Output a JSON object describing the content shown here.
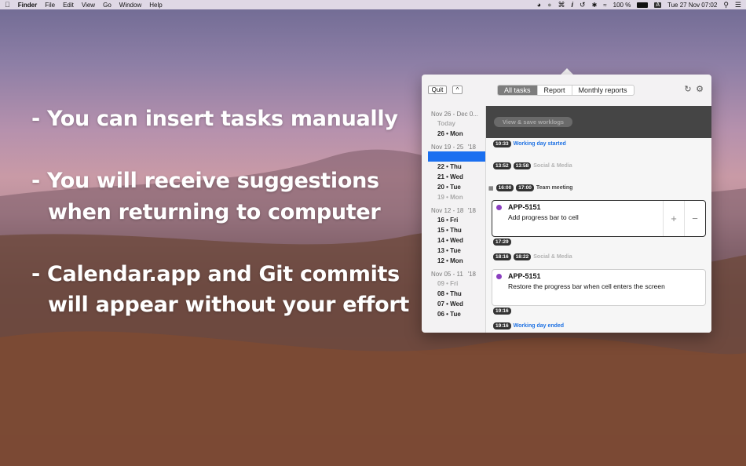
{
  "menubar": {
    "apple_icon": "apple-icon",
    "items": [
      "Finder",
      "File",
      "Edit",
      "View",
      "Go",
      "Window",
      "Help"
    ],
    "battery": "100 %",
    "input_source": "A",
    "datetime": "Tue 27 Nov  07:02"
  },
  "promo": {
    "line1": "- You can insert tasks manually",
    "line2a": "- You will receive suggestions",
    "line2b": "when returning to computer",
    "line3a": "- Calendar.app and Git commits",
    "line3b": "will appear without your effort"
  },
  "toolbar": {
    "quit_label": "Quit",
    "collapse_label": "^",
    "tabs": [
      "All tasks",
      "Report",
      "Monthly reports"
    ],
    "active_tab": "All tasks",
    "refresh_icon": "refresh-icon",
    "settings_icon": "gear-icon"
  },
  "sidebar": {
    "weeks": [
      {
        "header": "Nov 26 - Dec 0...",
        "year": "",
        "days": [
          {
            "label": "Today",
            "dim": true
          },
          {
            "label": "26 • Mon",
            "dim": false
          }
        ]
      },
      {
        "header": "Nov 19 - 25",
        "year": "'18",
        "days": [
          {
            "label": "",
            "selected": true
          },
          {
            "label": "22 • Thu"
          },
          {
            "label": "21 • Wed"
          },
          {
            "label": "20 • Tue"
          },
          {
            "label": "19 • Mon",
            "dim": true
          }
        ]
      },
      {
        "header": "Nov 12 - 18",
        "year": "'18",
        "days": [
          {
            "label": "16 • Fri"
          },
          {
            "label": "15 • Thu"
          },
          {
            "label": "14 • Wed"
          },
          {
            "label": "13 • Tue"
          },
          {
            "label": "12 • Mon"
          }
        ]
      },
      {
        "header": "Nov 05 - 11",
        "year": "'18",
        "days": [
          {
            "label": "09 • Fri",
            "dim": true
          },
          {
            "label": "08 • Thu"
          },
          {
            "label": "07 • Wed"
          },
          {
            "label": "06 • Tue"
          }
        ]
      }
    ]
  },
  "main": {
    "view_save_label": "View & save worklogs",
    "events": {
      "day_started": {
        "time": "10:33",
        "text": "Working day started"
      },
      "social1": {
        "start": "13:52",
        "end": "13:58",
        "text": "Social & Media"
      },
      "meeting": {
        "start": "16:00",
        "end": "17:00",
        "text": "Team meeting"
      },
      "gap": {
        "time": "17:29"
      },
      "social2": {
        "start": "18:16",
        "end": "18:22",
        "text": "Social & Media"
      },
      "end_time": {
        "time": "19:16"
      },
      "day_ended": {
        "time": "19:16",
        "text": "Working day ended"
      }
    },
    "cards": [
      {
        "key": "APP-5151",
        "description": "Add progress bar to cell",
        "plus": "+",
        "minus": "−",
        "color": "#8a3fbf"
      },
      {
        "key": "APP-5151",
        "description": "Restore the progress bar when cell enters the screen",
        "color": "#8a3fbf"
      }
    ]
  }
}
